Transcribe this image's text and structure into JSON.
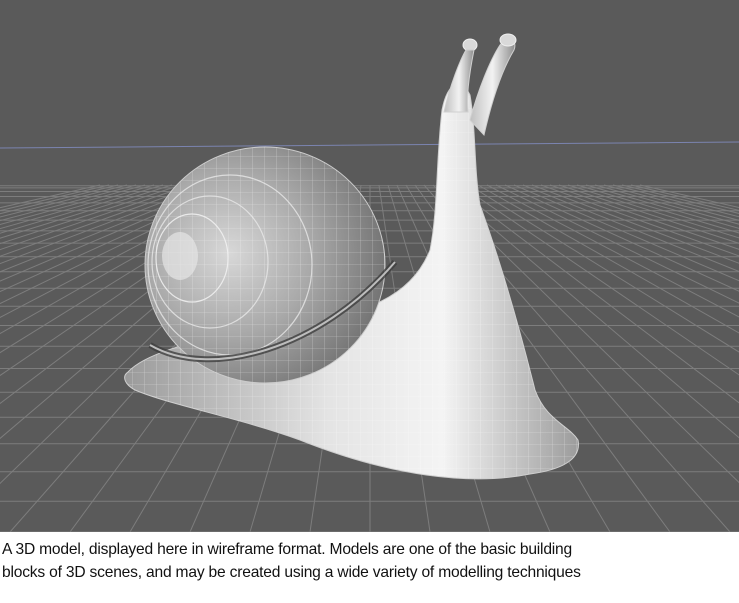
{
  "figure": {
    "caption_lines": [
      "A 3D model, displayed here in wireframe format. Models are one of the basic building",
      "blocks of 3D scenes, and may be created using a wide variety of modelling techniques"
    ]
  },
  "viewport": {
    "background_color": "#5a5a5a",
    "grid_color": "#7d7d7d",
    "horizon_line_color": "#7b84b0",
    "mesh_color": "#e8e8e8"
  }
}
